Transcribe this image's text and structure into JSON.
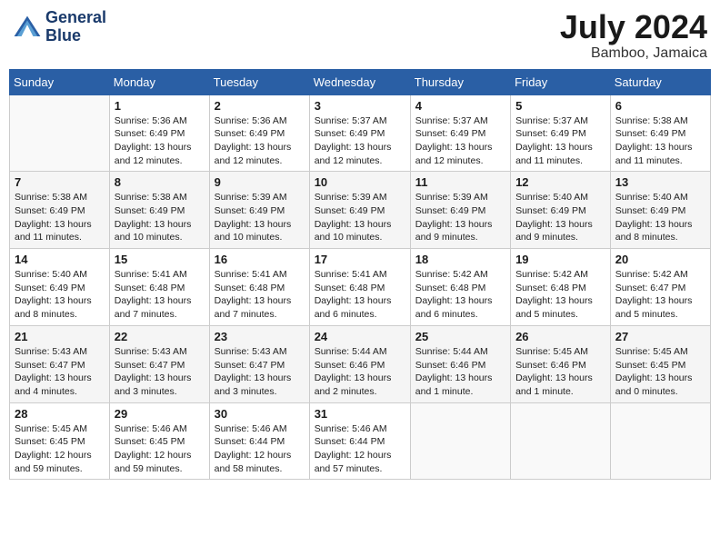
{
  "header": {
    "logo_line1": "General",
    "logo_line2": "Blue",
    "month": "July 2024",
    "location": "Bamboo, Jamaica"
  },
  "weekdays": [
    "Sunday",
    "Monday",
    "Tuesday",
    "Wednesday",
    "Thursday",
    "Friday",
    "Saturday"
  ],
  "weeks": [
    [
      {
        "day": "",
        "info": ""
      },
      {
        "day": "1",
        "info": "Sunrise: 5:36 AM\nSunset: 6:49 PM\nDaylight: 13 hours\nand 12 minutes."
      },
      {
        "day": "2",
        "info": "Sunrise: 5:36 AM\nSunset: 6:49 PM\nDaylight: 13 hours\nand 12 minutes."
      },
      {
        "day": "3",
        "info": "Sunrise: 5:37 AM\nSunset: 6:49 PM\nDaylight: 13 hours\nand 12 minutes."
      },
      {
        "day": "4",
        "info": "Sunrise: 5:37 AM\nSunset: 6:49 PM\nDaylight: 13 hours\nand 12 minutes."
      },
      {
        "day": "5",
        "info": "Sunrise: 5:37 AM\nSunset: 6:49 PM\nDaylight: 13 hours\nand 11 minutes."
      },
      {
        "day": "6",
        "info": "Sunrise: 5:38 AM\nSunset: 6:49 PM\nDaylight: 13 hours\nand 11 minutes."
      }
    ],
    [
      {
        "day": "7",
        "info": "Sunrise: 5:38 AM\nSunset: 6:49 PM\nDaylight: 13 hours\nand 11 minutes."
      },
      {
        "day": "8",
        "info": "Sunrise: 5:38 AM\nSunset: 6:49 PM\nDaylight: 13 hours\nand 10 minutes."
      },
      {
        "day": "9",
        "info": "Sunrise: 5:39 AM\nSunset: 6:49 PM\nDaylight: 13 hours\nand 10 minutes."
      },
      {
        "day": "10",
        "info": "Sunrise: 5:39 AM\nSunset: 6:49 PM\nDaylight: 13 hours\nand 10 minutes."
      },
      {
        "day": "11",
        "info": "Sunrise: 5:39 AM\nSunset: 6:49 PM\nDaylight: 13 hours\nand 9 minutes."
      },
      {
        "day": "12",
        "info": "Sunrise: 5:40 AM\nSunset: 6:49 PM\nDaylight: 13 hours\nand 9 minutes."
      },
      {
        "day": "13",
        "info": "Sunrise: 5:40 AM\nSunset: 6:49 PM\nDaylight: 13 hours\nand 8 minutes."
      }
    ],
    [
      {
        "day": "14",
        "info": "Sunrise: 5:40 AM\nSunset: 6:49 PM\nDaylight: 13 hours\nand 8 minutes."
      },
      {
        "day": "15",
        "info": "Sunrise: 5:41 AM\nSunset: 6:48 PM\nDaylight: 13 hours\nand 7 minutes."
      },
      {
        "day": "16",
        "info": "Sunrise: 5:41 AM\nSunset: 6:48 PM\nDaylight: 13 hours\nand 7 minutes."
      },
      {
        "day": "17",
        "info": "Sunrise: 5:41 AM\nSunset: 6:48 PM\nDaylight: 13 hours\nand 6 minutes."
      },
      {
        "day": "18",
        "info": "Sunrise: 5:42 AM\nSunset: 6:48 PM\nDaylight: 13 hours\nand 6 minutes."
      },
      {
        "day": "19",
        "info": "Sunrise: 5:42 AM\nSunset: 6:48 PM\nDaylight: 13 hours\nand 5 minutes."
      },
      {
        "day": "20",
        "info": "Sunrise: 5:42 AM\nSunset: 6:47 PM\nDaylight: 13 hours\nand 5 minutes."
      }
    ],
    [
      {
        "day": "21",
        "info": "Sunrise: 5:43 AM\nSunset: 6:47 PM\nDaylight: 13 hours\nand 4 minutes."
      },
      {
        "day": "22",
        "info": "Sunrise: 5:43 AM\nSunset: 6:47 PM\nDaylight: 13 hours\nand 3 minutes."
      },
      {
        "day": "23",
        "info": "Sunrise: 5:43 AM\nSunset: 6:47 PM\nDaylight: 13 hours\nand 3 minutes."
      },
      {
        "day": "24",
        "info": "Sunrise: 5:44 AM\nSunset: 6:46 PM\nDaylight: 13 hours\nand 2 minutes."
      },
      {
        "day": "25",
        "info": "Sunrise: 5:44 AM\nSunset: 6:46 PM\nDaylight: 13 hours\nand 1 minute."
      },
      {
        "day": "26",
        "info": "Sunrise: 5:45 AM\nSunset: 6:46 PM\nDaylight: 13 hours\nand 1 minute."
      },
      {
        "day": "27",
        "info": "Sunrise: 5:45 AM\nSunset: 6:45 PM\nDaylight: 13 hours\nand 0 minutes."
      }
    ],
    [
      {
        "day": "28",
        "info": "Sunrise: 5:45 AM\nSunset: 6:45 PM\nDaylight: 12 hours\nand 59 minutes."
      },
      {
        "day": "29",
        "info": "Sunrise: 5:46 AM\nSunset: 6:45 PM\nDaylight: 12 hours\nand 59 minutes."
      },
      {
        "day": "30",
        "info": "Sunrise: 5:46 AM\nSunset: 6:44 PM\nDaylight: 12 hours\nand 58 minutes."
      },
      {
        "day": "31",
        "info": "Sunrise: 5:46 AM\nSunset: 6:44 PM\nDaylight: 12 hours\nand 57 minutes."
      },
      {
        "day": "",
        "info": ""
      },
      {
        "day": "",
        "info": ""
      },
      {
        "day": "",
        "info": ""
      }
    ]
  ]
}
